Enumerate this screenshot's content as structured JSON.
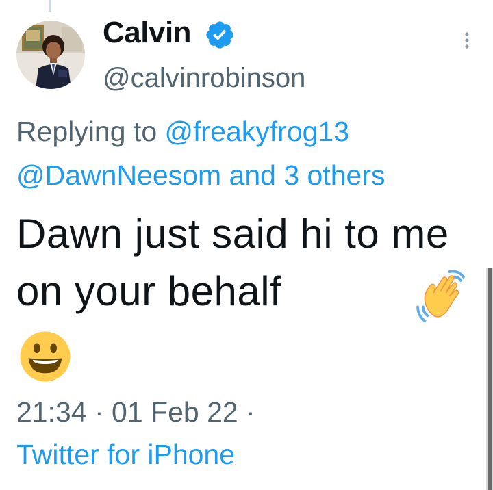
{
  "author": {
    "display_name": "Calvin",
    "handle": "@calvinrobinson",
    "verified_icon": "verified-badge-icon",
    "avatar_icon": "profile-photo"
  },
  "reply": {
    "prefix": "Replying to ",
    "mention_1": "@freakyfrog13",
    "mention_2": "@DawnNeesom",
    "connector": " and ",
    "others": "3 others"
  },
  "tweet": {
    "text": "Dawn just said hi to me on your behalf",
    "emoji_1": "waving-hand-icon",
    "emoji_2": "smiling-face-icon"
  },
  "meta": {
    "time": "21:34",
    "separator": " · ",
    "date": "01 Feb 22",
    "trailing_separator": " ·",
    "source": "Twitter for iPhone"
  },
  "colors": {
    "link": "#1d9bf0",
    "secondary_text": "#536471",
    "primary_text": "#0f1419"
  },
  "more_icon": "more-vertical-icon"
}
